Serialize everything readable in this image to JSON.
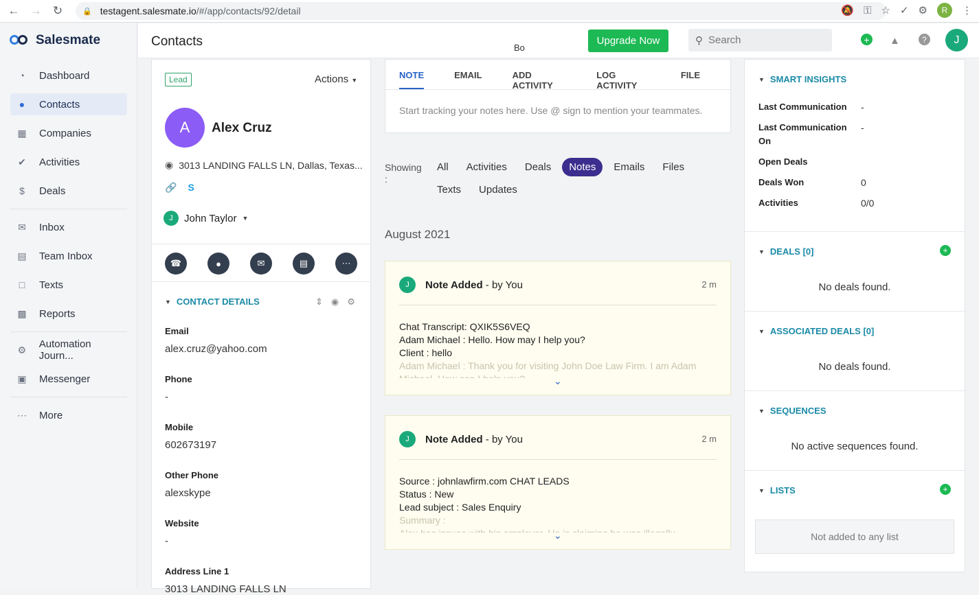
{
  "browser": {
    "url_host": "testagent.salesmate.io",
    "url_path": "/#/app/contacts/92/detail",
    "profile_initial": "R"
  },
  "sidebar": {
    "brand": "Salesmate",
    "items": [
      {
        "label": "Dashboard",
        "icon": "dashboard-icon"
      },
      {
        "label": "Contacts",
        "icon": "person-icon",
        "active": true
      },
      {
        "label": "Companies",
        "icon": "building-icon"
      },
      {
        "label": "Activities",
        "icon": "check-circle-icon"
      },
      {
        "label": "Deals",
        "icon": "dollar-icon"
      },
      {
        "label": "Inbox",
        "icon": "mail-icon"
      },
      {
        "label": "Team Inbox",
        "icon": "inbox-tray-icon"
      },
      {
        "label": "Texts",
        "icon": "chat-icon"
      },
      {
        "label": "Reports",
        "icon": "bar-chart-icon"
      },
      {
        "label": "Automation Journ...",
        "icon": "automation-icon"
      },
      {
        "label": "Messenger",
        "icon": "messenger-icon"
      },
      {
        "label": "More",
        "icon": "more-icon"
      }
    ]
  },
  "topbar": {
    "title": "Contacts",
    "partial_text": "Bo",
    "upgrade_label": "Upgrade Now",
    "search_placeholder": "Search",
    "user_initial": "J",
    "accent": "#1db954"
  },
  "contact": {
    "badge": "Lead",
    "actions_label": "Actions",
    "initial": "A",
    "name": "Alex Cruz",
    "address": "3013 LANDING FALLS LN, Dallas, Texas...",
    "owner_initial": "J",
    "owner": "John Taylor",
    "section_title": "CONTACT DETAILS",
    "fields": [
      {
        "label": "Email",
        "value": "alex.cruz@yahoo.com"
      },
      {
        "label": "Phone",
        "value": "-"
      },
      {
        "label": "Mobile",
        "value": "602673197"
      },
      {
        "label": "Other Phone",
        "value": "alexskype"
      },
      {
        "label": "Website",
        "value": "-"
      },
      {
        "label": "Address Line 1",
        "value": "3013 LANDING FALLS LN"
      }
    ]
  },
  "composer": {
    "tabs": [
      "NOTE",
      "EMAIL",
      "ADD ACTIVITY",
      "LOG ACTIVITY",
      "FILE"
    ],
    "placeholder": "Start tracking your notes here. Use @ sign to mention your teammates."
  },
  "filters": {
    "showing_label": "Showing :",
    "tabs": [
      "All",
      "Activities",
      "Deals",
      "Notes",
      "Emails",
      "Files",
      "Texts",
      "Updates"
    ],
    "active": "Notes"
  },
  "timeline": {
    "month": "August 2021",
    "notes": [
      {
        "avatar": "J",
        "title": "Note Added",
        "by": "- by You",
        "time": "2 m",
        "lines": [
          "Chat Transcript: QXIK5S6VEQ",
          "Adam Michael : Hello. How may I help you?",
          "Client : hello"
        ],
        "faded": [
          "Adam Michael : Thank you for visiting John Doe Law Firm. I am Adam",
          "Michael. How can I help you?"
        ]
      },
      {
        "avatar": "J",
        "title": "Note Added",
        "by": "- by You",
        "time": "2 m",
        "lines": [
          "Source : johnlawfirm.com CHAT LEADS",
          "Status : New",
          "Lead subject : Sales Enquiry"
        ],
        "faded": [
          "Summary :",
          "Alex has issues with his employer. He is claiming he was illegally"
        ]
      }
    ]
  },
  "insights": {
    "title": "SMART INSIGHTS",
    "rows": [
      {
        "label": "Last Communication",
        "value": "-"
      },
      {
        "label": "Last Communication On",
        "value": "-"
      },
      {
        "label": "Open Deals",
        "value": ""
      },
      {
        "label": "Deals Won",
        "value": "0"
      },
      {
        "label": "Activities",
        "value": "0/0"
      }
    ]
  },
  "panels": {
    "deals_title": "DEALS [0]",
    "deals_empty": "No deals found.",
    "assoc_title": "ASSOCIATED DEALS [0]",
    "assoc_empty": "No deals found.",
    "seq_title": "SEQUENCES",
    "seq_empty": "No active sequences found.",
    "lists_title": "LISTS",
    "lists_empty": "Not added to any list"
  }
}
